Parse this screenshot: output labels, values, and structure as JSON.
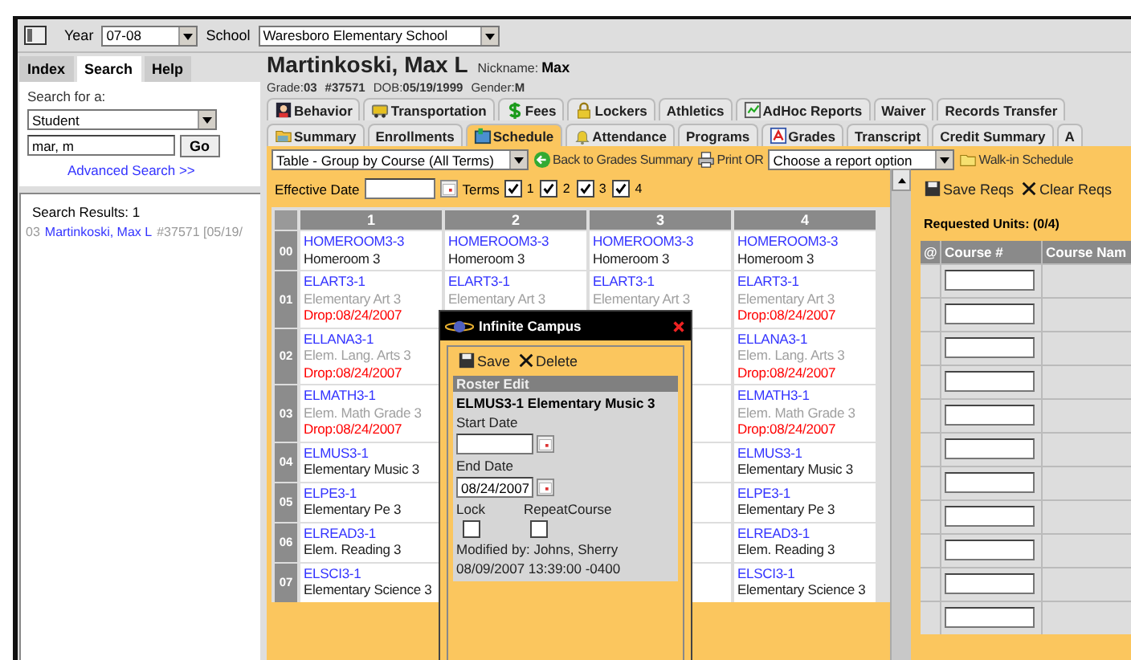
{
  "top_bar": {
    "year_label": "Year",
    "year": "07-08",
    "school_label": "School",
    "school": "Waresboro Elementary School"
  },
  "sidebar": {
    "tabs": [
      {
        "label": "Index",
        "selected": false
      },
      {
        "label": "Search",
        "selected": true
      },
      {
        "label": "Help",
        "selected": false
      }
    ],
    "search_for_label": "Search for a:",
    "search_type": "Student",
    "query": "mar, m",
    "go": "Go",
    "advanced_link": "Advanced Search >>",
    "results_title": "Search Results: 1",
    "results": [
      {
        "grade": "03",
        "name": "Martinkoski, Max L",
        "detail": "#37571 [05/19/"
      }
    ]
  },
  "student": {
    "name": "Martinkoski, Max L",
    "nickname_label": "Nickname:",
    "nickname": "Max",
    "info": [
      {
        "label": "Grade:",
        "value": "03"
      },
      {
        "value": "#37571"
      },
      {
        "label": "DOB:",
        "value": "05/19/1999"
      },
      {
        "label": "Gender:",
        "value": "M"
      }
    ]
  },
  "tabs_row_1": [
    {
      "label": "Behavior",
      "kind": "person",
      "selected": false
    },
    {
      "label": "Transportation",
      "kind": "bus",
      "selected": false
    },
    {
      "label": "Fees",
      "kind": "money",
      "selected": false
    },
    {
      "label": "Lockers",
      "kind": "lock",
      "selected": false
    },
    {
      "label": "Athletics",
      "kind": "plain",
      "selected": false
    },
    {
      "label": "AdHoc Reports",
      "kind": "report",
      "selected": false
    },
    {
      "label": "Waiver",
      "kind": "plain",
      "selected": false
    },
    {
      "label": "Records Transfer",
      "kind": "plain",
      "selected": false
    }
  ],
  "tabs_row_2": [
    {
      "label": "Summary",
      "kind": "folder",
      "selected": false
    },
    {
      "label": "Enrollments",
      "kind": "plain",
      "selected": false
    },
    {
      "label": "Schedule",
      "kind": "schedule",
      "selected": true
    },
    {
      "label": "Attendance",
      "kind": "bell",
      "selected": false
    },
    {
      "label": "Programs",
      "kind": "plain",
      "selected": false
    },
    {
      "label": "Grades",
      "kind": "grades",
      "selected": false
    },
    {
      "label": "Transcript",
      "kind": "plain",
      "selected": false
    },
    {
      "label": "Credit Summary",
      "kind": "plain",
      "selected": false
    },
    {
      "label": "A",
      "kind": "plain",
      "selected": false
    }
  ],
  "schedule_toolbar": {
    "view": "Table - Group by Course (All Terms)",
    "back": "Back to Grades Summary",
    "print": "Print OR",
    "report": "Choose a report option",
    "walk_in": "Walk-in Schedule"
  },
  "effective_date_label": "Effective Date",
  "terms_label": "Terms",
  "terms": [
    {
      "label": "1",
      "checked": true
    },
    {
      "label": "2",
      "checked": true
    },
    {
      "label": "3",
      "checked": true
    },
    {
      "label": "4",
      "checked": true
    }
  ],
  "grid": {
    "columns": [
      "1",
      "2",
      "3",
      "4"
    ],
    "rows": [
      {
        "period": "00",
        "cells": [
          {
            "code": "HOMEROOM3-3",
            "name": "Homeroom 3",
            "dropped": false
          },
          {
            "code": "HOMEROOM3-3",
            "name": "Homeroom 3",
            "dropped": false
          },
          {
            "code": "HOMEROOM3-3",
            "name": "Homeroom 3",
            "dropped": false
          },
          {
            "code": "HOMEROOM3-3",
            "name": "Homeroom 3",
            "dropped": false
          }
        ]
      },
      {
        "period": "01",
        "cells": [
          {
            "code": "ELART3-1",
            "name": "Elementary Art 3",
            "dropped": true,
            "drop": "Drop:08/24/2007"
          },
          {
            "code": "ELART3-1",
            "name": "Elementary Art 3",
            "dropped": true
          },
          {
            "code": "ELART3-1",
            "name": "Elementary Art 3",
            "dropped": true
          },
          {
            "code": "ELART3-1",
            "name": "Elementary Art 3",
            "dropped": true,
            "drop": "Drop:08/24/2007"
          }
        ]
      },
      {
        "period": "02",
        "cells": [
          {
            "code": "ELLANA3-1",
            "name": "Elem. Lang. Arts 3",
            "dropped": true,
            "drop": "Drop:08/24/2007"
          },
          null,
          null,
          {
            "code": "ELLANA3-1",
            "name": "Elem. Lang. Arts 3",
            "dropped": true,
            "drop": "Drop:08/24/2007"
          }
        ]
      },
      {
        "period": "03",
        "cells": [
          {
            "code": "ELMATH3-1",
            "name": "Elem. Math Grade 3",
            "dropped": true,
            "drop": "Drop:08/24/2007"
          },
          null,
          null,
          {
            "code": "ELMATH3-1",
            "name": "Elem. Math Grade 3",
            "dropped": true,
            "drop": "Drop:08/24/2007"
          }
        ]
      },
      {
        "period": "04",
        "cells": [
          {
            "code": "ELMUS3-1",
            "name": "Elementary Music 3",
            "dropped": false
          },
          null,
          null,
          {
            "code": "ELMUS3-1",
            "name": "Elementary Music 3",
            "dropped": false
          }
        ]
      },
      {
        "period": "05",
        "cells": [
          {
            "code": "ELPE3-1",
            "name": "Elementary Pe 3",
            "dropped": false
          },
          null,
          null,
          {
            "code": "ELPE3-1",
            "name": "Elementary Pe 3",
            "dropped": false
          }
        ]
      },
      {
        "period": "06",
        "cells": [
          {
            "code": "ELREAD3-1",
            "name": "Elem. Reading 3",
            "dropped": false
          },
          null,
          null,
          {
            "code": "ELREAD3-1",
            "name": "Elem. Reading 3",
            "dropped": false
          }
        ]
      },
      {
        "period": "07",
        "cells": [
          {
            "code": "ELSCI3-1",
            "name": "Elementary Science 3",
            "dropped": false
          },
          null,
          null,
          {
            "code": "ELSCI3-1",
            "name": "Elementary Science 3",
            "dropped": false
          }
        ]
      }
    ]
  },
  "popup": {
    "title": "Infinite Campus",
    "save": "Save",
    "delete": "Delete",
    "section": "Roster Edit",
    "course": "ELMUS3-1 Elementary Music 3",
    "start_label": "Start Date",
    "end_label": "End Date",
    "end": "08/24/2007",
    "lock_label": "Lock",
    "lock": false,
    "repeat_label": "RepeatCourse",
    "repeat": false,
    "modified": "Modified by: Johns, Sherry",
    "timestamp": "08/09/2007 13:39:00 -0400"
  },
  "requests": {
    "save": "Save Reqs",
    "clear": "Clear Reqs",
    "units": "Requested Units: (0/4)",
    "columns": [
      "@",
      "Course #",
      "Course Nam"
    ],
    "rows": [
      {
        "kind": "input"
      },
      {
        "kind": "input"
      },
      {
        "kind": "input"
      },
      {
        "kind": "input"
      },
      {
        "kind": "input"
      },
      {
        "kind": "input"
      },
      {
        "kind": "input"
      },
      {
        "kind": "input"
      },
      {
        "kind": "input"
      },
      {
        "kind": "input"
      },
      {
        "kind": "input"
      }
    ]
  }
}
